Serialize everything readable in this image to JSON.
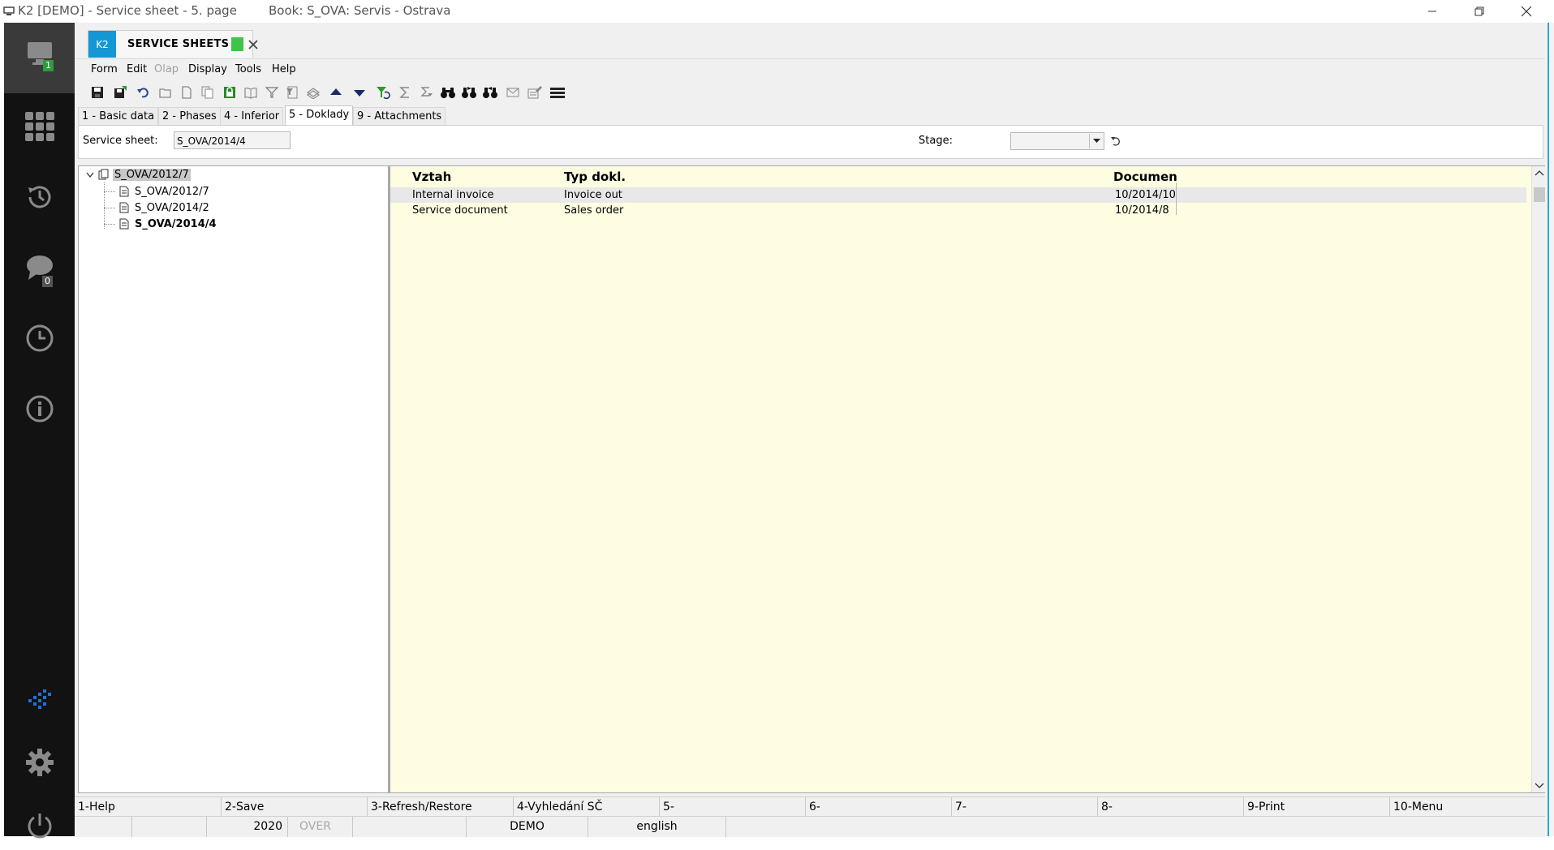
{
  "window": {
    "title": "K2 [DEMO] - Service sheet - 5. page",
    "book": "Book: S_OVA: Servis - Ostrava"
  },
  "sidebar": {
    "workspace_badge": "1",
    "chat_badge": "0"
  },
  "doc_tab": {
    "app_label": "K2",
    "name": "SERVICE SHEETS",
    "status_color": "#3ec449"
  },
  "menu": [
    "Form",
    "Edit",
    "Olap",
    "Display",
    "Tools",
    "Help"
  ],
  "menu_disabled": [
    "Olap"
  ],
  "page_tabs": [
    "1 - Basic data",
    "2 - Phases",
    "4 - Inferior",
    "5 - Doklady",
    "9 - Attachments"
  ],
  "active_page_tab": "5 - Doklady",
  "form": {
    "service_sheet_label": "Service sheet:",
    "service_sheet_value": "S_OVA/2014/4",
    "stage_label": "Stage:",
    "stage_value": ""
  },
  "tree": {
    "root": "S_OVA/2012/7",
    "children": [
      "S_OVA/2012/7",
      "S_OVA/2014/2",
      "S_OVA/2014/4"
    ]
  },
  "grid": {
    "columns": [
      "Vztah",
      "Typ dokl.",
      "Document"
    ],
    "rows": [
      [
        "Internal invoice",
        "Invoice out",
        "10/2014/10"
      ],
      [
        "Service document",
        "Sales order",
        "10/2014/8"
      ]
    ]
  },
  "function_keys": [
    "1-Help",
    "2-Save",
    "3-Refresh/Restore",
    "4-Vyhledání SČ",
    "5-",
    "6-",
    "7-",
    "8-",
    "9-Print",
    "10-Menu"
  ],
  "status": {
    "year": "2020",
    "mode": "OVER",
    "database": "DEMO",
    "language": "english"
  },
  "colors": {
    "accent": "#1497d4",
    "sidebar_bg": "#121212",
    "grid_bg": "#fefde2"
  }
}
